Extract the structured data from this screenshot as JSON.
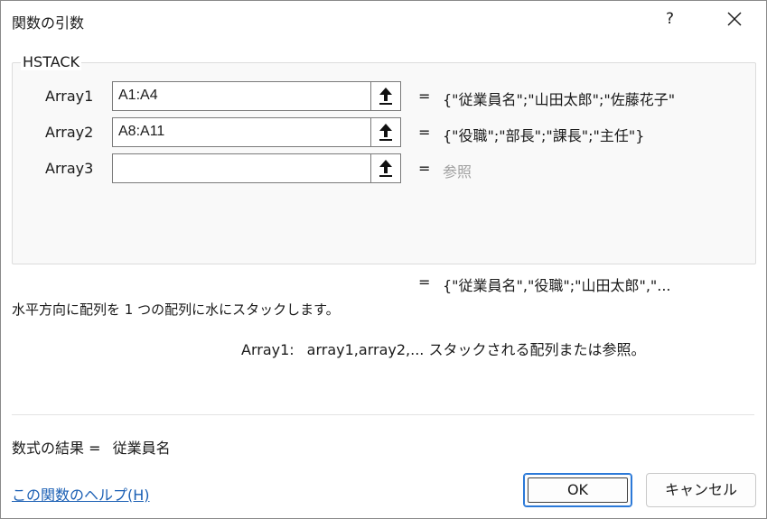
{
  "window": {
    "title": "関数の引数",
    "help_label": "?"
  },
  "function_group": {
    "label": "HSTACK",
    "args": [
      {
        "label": "Array1",
        "value": "A1:A4",
        "equals": "=",
        "result": "{\"従業員名\";\"山田太郎\";\"佐藤花子\""
      },
      {
        "label": "Array2",
        "value": "A8:A11",
        "equals": "=",
        "result": "{\"役職\";\"部長\";\"課長\";\"主任\"}"
      },
      {
        "label": "Array3",
        "value": "",
        "equals": "=",
        "result": "参照"
      }
    ]
  },
  "overall_result": {
    "equals": "=",
    "value": "{\"従業員名\",\"役職\";\"山田太郎\",\"..."
  },
  "description": "水平方向に配列を 1 つの配列に水にスタックします。",
  "arg_description": {
    "name": "Array1:",
    "text": "array1,array2,... スタックされる配列または参照。"
  },
  "formula_result": {
    "label": "数式の結果 =",
    "value": "従業員名"
  },
  "footer": {
    "help_link": "この関数のヘルプ(H)",
    "ok_label": "OK",
    "cancel_label": "キャンセル"
  },
  "colors": {
    "accent": "#2b79d8",
    "link": "#1a5fb4",
    "placeholder": "#a0a0a0"
  }
}
